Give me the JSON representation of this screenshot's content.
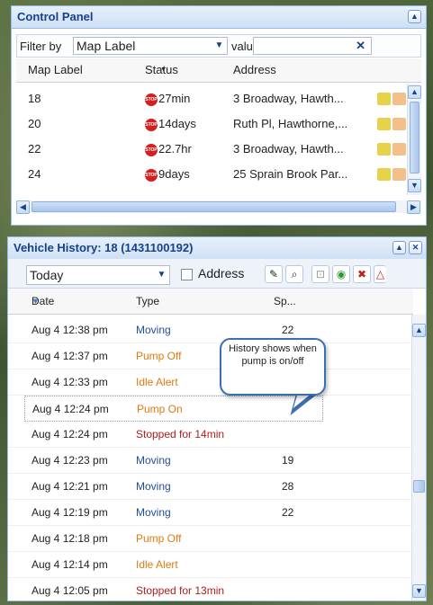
{
  "control_panel": {
    "title": "Control Panel",
    "filter_label": "Filter by",
    "filter_value": "Map Label",
    "value_label": "value",
    "value_input": "",
    "columns": [
      "Map Label",
      "Status",
      "Address"
    ],
    "rows": [
      {
        "label": "18",
        "status": "27min",
        "address": "3 Broadway, Hawth..."
      },
      {
        "label": "20",
        "status": "14days",
        "address": "Ruth Pl, Hawthorne,..."
      },
      {
        "label": "22",
        "status": "22.7hr",
        "address": "3 Broadway, Hawth..."
      },
      {
        "label": "24",
        "status": "9days",
        "address": "25 Sprain Brook Par..."
      }
    ],
    "stop_icon_text": "STOP"
  },
  "vehicle_history": {
    "title": "Vehicle History: 18 (1431100192)",
    "range_value": "Today",
    "address_label": "Address",
    "columns": {
      "date": "Date",
      "type": "Type",
      "speed": "Sp..."
    },
    "rows": [
      {
        "date": "Aug 4 12:38 pm",
        "type": "Moving",
        "kind": "moving",
        "speed": "22"
      },
      {
        "date": "Aug 4 12:37 pm",
        "type": "Pump Off",
        "kind": "pump",
        "speed": ""
      },
      {
        "date": "Aug 4 12:33 pm",
        "type": "Idle Alert",
        "kind": "idle",
        "speed": ""
      },
      {
        "date": "Aug 4 12:24 pm",
        "type": "Pump On",
        "kind": "pump",
        "speed": ""
      },
      {
        "date": "Aug 4 12:24 pm",
        "type": "Stopped for 14min",
        "kind": "stopped",
        "speed": ""
      },
      {
        "date": "Aug 4 12:23 pm",
        "type": "Moving",
        "kind": "moving",
        "speed": "19"
      },
      {
        "date": "Aug 4 12:21 pm",
        "type": "Moving",
        "kind": "moving",
        "speed": "28"
      },
      {
        "date": "Aug 4 12:19 pm",
        "type": "Moving",
        "kind": "moving",
        "speed": "22"
      },
      {
        "date": "Aug 4 12:18 pm",
        "type": "Pump Off",
        "kind": "pump",
        "speed": ""
      },
      {
        "date": "Aug 4 12:14 pm",
        "type": "Idle Alert",
        "kind": "idle",
        "speed": ""
      },
      {
        "date": "Aug 4 12:05 pm",
        "type": "Stopped for 13min",
        "kind": "stopped",
        "speed": ""
      }
    ],
    "callout": "History shows when pump is on/off"
  },
  "colors": {
    "header_text": "#15428b",
    "moving": "#1f4e9c",
    "pump": "#e07a10",
    "stopped": "#b01c1c",
    "stop_icon": "#d21f1f"
  }
}
